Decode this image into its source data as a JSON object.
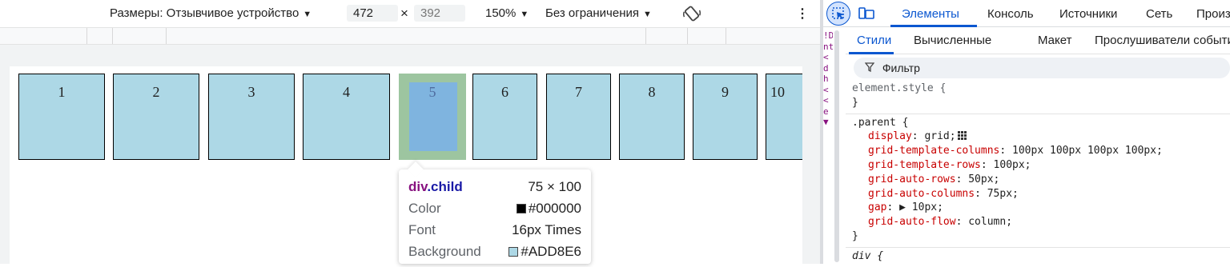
{
  "device_toolbar": {
    "dimensions_label": "Размеры: Отзывчивое устройство",
    "width_value": "472",
    "times_sign": "×",
    "height_value": "392",
    "zoom": "150%",
    "throttle": "Без ограничения"
  },
  "grid_cells": [
    "1",
    "2",
    "3",
    "4",
    "5",
    "6",
    "7",
    "8",
    "9",
    "10"
  ],
  "tooltip": {
    "tag": "div",
    "class_name": ".child",
    "size": "75 × 100",
    "color_label": "Color",
    "color_value": "#000000",
    "font_label": "Font",
    "font_value": "16px Times",
    "background_label": "Background",
    "background_value": "#ADD8E6"
  },
  "devtools": {
    "main_tabs": [
      "Элементы",
      "Консоль",
      "Источники",
      "Сеть",
      "Произ"
    ],
    "sub_tabs": [
      "Стили",
      "Вычисленные",
      "Макет",
      "Прослушиватели событий"
    ],
    "filter_placeholder": "Фильтр",
    "dom_strip": [
      "!D",
      "nt",
      "<",
      "d",
      "h",
      "<",
      "<",
      "e",
      "▼"
    ]
  },
  "styles": {
    "element_style": {
      "selector": "element.style {",
      "close": "}"
    },
    "parent_rule": {
      "selector": ".parent {",
      "declarations": [
        {
          "prop": "display",
          "value": "grid;"
        },
        {
          "prop": "grid-template-columns",
          "value": "100px 100px 100px 100px;"
        },
        {
          "prop": "grid-template-rows",
          "value": "100px;"
        },
        {
          "prop": "grid-auto-rows",
          "value": "50px;"
        },
        {
          "prop": "grid-auto-columns",
          "value": "75px;"
        },
        {
          "prop": "gap",
          "value": "▶ 10px;"
        },
        {
          "prop": "grid-auto-flow",
          "value": "column;"
        }
      ],
      "close": "}"
    },
    "div_rule": {
      "selector": "div {"
    }
  },
  "colors": {
    "accent": "#0b57d0",
    "cell_bg": "#add8e6",
    "highlight_margin": "#9dc5a0",
    "highlight_content": "#7fb4df",
    "css_property": "#c80000"
  }
}
